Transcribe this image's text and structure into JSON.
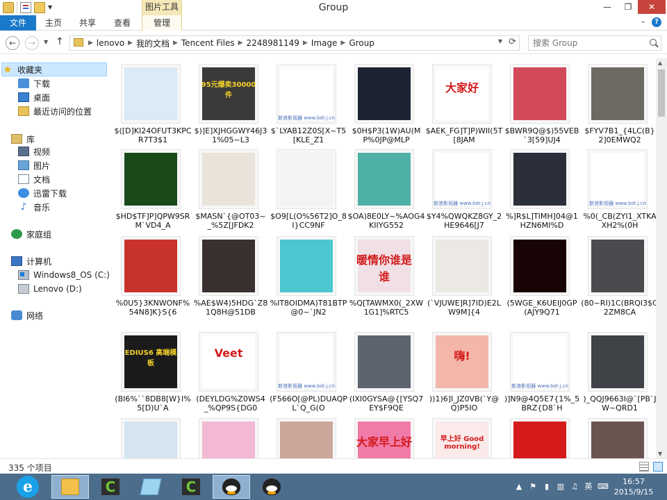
{
  "window": {
    "title": "Group",
    "context_tab": "图片工具",
    "minimize": "—",
    "maximize": "❐",
    "close": "✕"
  },
  "ribbon": {
    "tabs": [
      {
        "label": "文件"
      },
      {
        "label": "主页"
      },
      {
        "label": "共享"
      },
      {
        "label": "查看"
      },
      {
        "label": "管理"
      }
    ],
    "collapse": "⌄",
    "help": "?"
  },
  "address": {
    "crumbs": [
      "lenovo",
      "我的文档",
      "Tencent Files",
      "2248981149",
      "Image",
      "Group"
    ],
    "search_placeholder": "搜索 Group"
  },
  "nav_pane": {
    "items": [
      {
        "label": "收藏夹",
        "icon": "star-icon"
      },
      {
        "label": "下载",
        "icon": "download-folder-icon"
      },
      {
        "label": "桌面",
        "icon": "desktop-icon"
      },
      {
        "label": "最近访问的位置",
        "icon": "recent-places-icon"
      },
      {
        "label": "库",
        "icon": "library-icon"
      },
      {
        "label": "视频",
        "icon": "videos-icon"
      },
      {
        "label": "图片",
        "icon": "pictures-icon"
      },
      {
        "label": "文档",
        "icon": "documents-icon"
      },
      {
        "label": "迅雷下载",
        "icon": "xunlei-icon"
      },
      {
        "label": "音乐",
        "icon": "music-icon"
      },
      {
        "label": "家庭组",
        "icon": "homegroup-icon"
      },
      {
        "label": "计算机",
        "icon": "computer-icon"
      },
      {
        "label": "Windows8_OS (C:)",
        "icon": "os-drive-icon"
      },
      {
        "label": "Lenovo (D:)",
        "icon": "drive-icon"
      },
      {
        "label": "网络",
        "icon": "network-icon"
      }
    ]
  },
  "files": [
    {
      "name": "$([D]KI24OFUT3KPCR7T3$1",
      "color": "#dbeaf5",
      "text": ""
    },
    {
      "name": "$)]E]XJHGGWY46J31%05~L3",
      "color": "#3a3a38",
      "text": "95元爆卖30000件"
    },
    {
      "name": "$`LYAB12Z0S[X~T5[KLE_Z1",
      "color": "#ffffff",
      "text": "新浪影视器 www.bdr.j.cn"
    },
    {
      "name": "$0H$P3(1W)AU(MP%0JP@MLP",
      "color": "#1c2433",
      "text": ""
    },
    {
      "name": "$AEK_FG]T]P)WII(5T[8JAM",
      "color": "#ffffff",
      "text": "大家好"
    },
    {
      "name": "$BWR9Q@$)55VEB`3[59]UJ4",
      "color": "#d24a5a",
      "text": ""
    },
    {
      "name": "$FYV7B1_{4LC(B}2]0EMWQ2",
      "color": "#6d6a62",
      "text": ""
    },
    {
      "name": "$HD$TF]P]QPW9SRM`VD4_A",
      "color": "#1a4a1a",
      "text": ""
    },
    {
      "name": "$MASN`{@OT03~_%5Z[JFDK2",
      "color": "#e9e3da",
      "text": ""
    },
    {
      "name": "$O9[L(O%56T2]O_8I}CC9NF",
      "color": "#f3f3f3",
      "text": ""
    },
    {
      "name": "$OA)8E0LY~%AOG4KIIYG552",
      "color": "#4fb0a5",
      "text": ""
    },
    {
      "name": "$Y4%QWQKZ8GY_2HE9646[J7",
      "color": "#ffffff",
      "text": "新浪影视器 www.bdr.j.cn"
    },
    {
      "name": "%]R$L]TIMH]04@1HZN6MI%D",
      "color": "#2b2f3a",
      "text": ""
    },
    {
      "name": "%0(_CB(ZYI1_XTKAXH2%(0H",
      "color": "#ffffff",
      "text": "新浪影视器 www.bdr.j.cn"
    },
    {
      "name": "%0U5}3KNWONF%54N8]K}S{6",
      "color": "#c8322c",
      "text": ""
    },
    {
      "name": "%AE$W4)5HDG`Z81Q8H@51DB",
      "color": "#3a3030",
      "text": ""
    },
    {
      "name": "%IT8OIDMA)T81BTP@0~`JN2",
      "color": "#4cc6cf",
      "text": ""
    },
    {
      "name": "%Q[TAWMX0(_2XW1G1]%RTC5",
      "color": "#f0e0e6",
      "text": "暖情你谁是谁"
    },
    {
      "name": "(`VJUWE]R]7ID)E2LW9M]{4",
      "color": "#ece8e4",
      "text": ""
    },
    {
      "name": "(5WGE_K6UEIJ0GP(AJY9Q71",
      "color": "#180404",
      "text": ""
    },
    {
      "name": "(80~RI)1C(BRQI3$Q2ZM8CA",
      "color": "#494b4f",
      "text": ""
    },
    {
      "name": "(BI6%``8DB8[W}I%5[D)U`A",
      "color": "#1b1b1b",
      "text": "EDIUS6 高端模板"
    },
    {
      "name": "(DEYLDG%Z0WS4_%QP9S{DG0",
      "color": "#ffffff",
      "text": "Veet"
    },
    {
      "name": "(F566O[@PL)DUAQPL`Q_G(O",
      "color": "#ffffff",
      "text": "新浪影视器 www.bdr.j.cn"
    },
    {
      "name": "(IXI0GYSA@{[YSQ7EY$F9QE",
      "color": "#5d6470",
      "text": ""
    },
    {
      "name": "))1)6]I_JZ0VB(`Y@Q)P5IO",
      "color": "#f3b6a8",
      "text": "嗨!"
    },
    {
      "name": ")]N9@4Q5E7{1%_5BRZ{D8`H",
      "color": "#ffffff",
      "text": "新浪影视器 www.bdr.j.cn"
    },
    {
      "name": ")_QQJ9663I@`[PB`JW~QRD1",
      "color": "#3f4247",
      "text": ""
    },
    {
      "name": "",
      "color": "#d5e4ef",
      "text": ""
    },
    {
      "name": "",
      "color": "#f2b8d4",
      "text": ""
    },
    {
      "name": "",
      "color": "#caa79a",
      "text": ""
    },
    {
      "name": "",
      "color": "#f07aa8",
      "text": "大家早上好"
    },
    {
      "name": "",
      "color": "#fbeaea",
      "text": "早上好 Good morning!"
    },
    {
      "name": "",
      "color": "#d51a1a",
      "text": ""
    },
    {
      "name": "",
      "color": "#6a5450",
      "text": ""
    }
  ],
  "status": {
    "count": "335 个项目"
  },
  "taskbar": {
    "clock_time": "16:57",
    "clock_date": "2015/9/15",
    "ime": "英",
    "apps": [
      {
        "name": "explorer"
      },
      {
        "name": "camtasia"
      },
      {
        "name": "notepad"
      },
      {
        "name": "camtasia-2"
      },
      {
        "name": "qq"
      },
      {
        "name": "qq-2"
      }
    ]
  }
}
